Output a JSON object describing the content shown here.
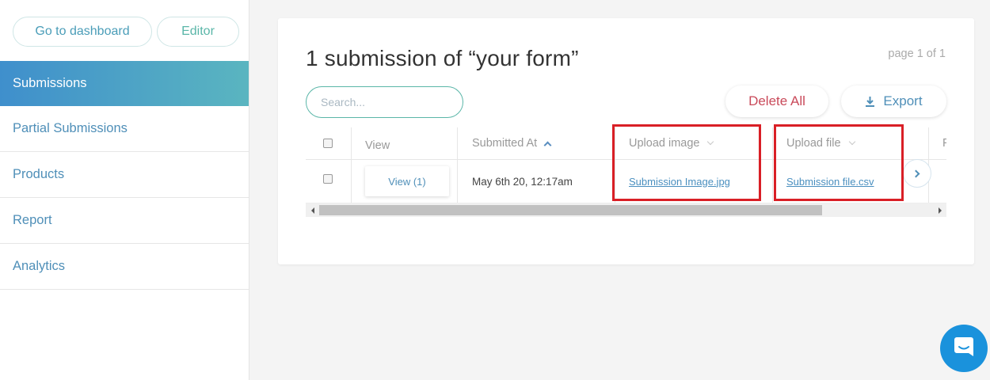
{
  "sidebar": {
    "go_to_dashboard": "Go to dashboard",
    "editor": "Editor",
    "items": [
      {
        "label": "Submissions",
        "active": true
      },
      {
        "label": "Partial Submissions"
      },
      {
        "label": "Products"
      },
      {
        "label": "Report"
      },
      {
        "label": "Analytics"
      }
    ]
  },
  "main": {
    "title": "1 submission of “your form”",
    "page_info": "page 1 of 1",
    "search_placeholder": "Search...",
    "delete_all": "Delete All",
    "export": "Export",
    "table": {
      "headers": {
        "view": "View",
        "submitted_at": "Submitted At",
        "upload_image": "Upload image",
        "upload_file": "Upload file",
        "partial": "F"
      },
      "rows": [
        {
          "view": "View (1)",
          "submitted_at": "May 6th 20, 12:17am",
          "upload_image": "Submission Image.jpg",
          "upload_file": "Submission file.csv"
        }
      ]
    }
  },
  "colors": {
    "accent_teal": "#5ab6a8",
    "link_blue": "#4f8fb8",
    "delete_red": "#c94a5a",
    "highlight_red": "#d91f26",
    "chat_blue": "#1a92dc"
  },
  "icons": [
    "download-icon",
    "sort-up-icon",
    "chevron-down-icon",
    "chevron-right-icon",
    "chat-icon"
  ]
}
